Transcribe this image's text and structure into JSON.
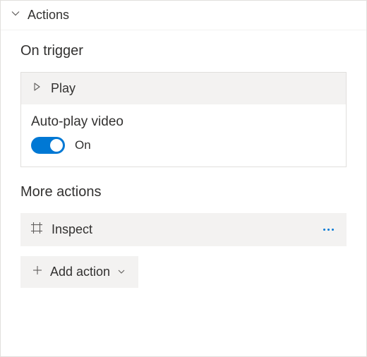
{
  "panel": {
    "title": "Actions"
  },
  "sections": {
    "on_trigger": {
      "title": "On trigger",
      "action": {
        "name": "Play",
        "property": {
          "label": "Auto-play video",
          "state_label": "On",
          "value": true
        }
      }
    },
    "more_actions": {
      "title": "More actions",
      "items": [
        {
          "name": "Inspect"
        }
      ],
      "add_button_label": "Add action"
    }
  },
  "colors": {
    "accent": "#0078d4",
    "panel_bg": "#f3f2f1",
    "border": "#e1dfdd",
    "text": "#323130"
  }
}
